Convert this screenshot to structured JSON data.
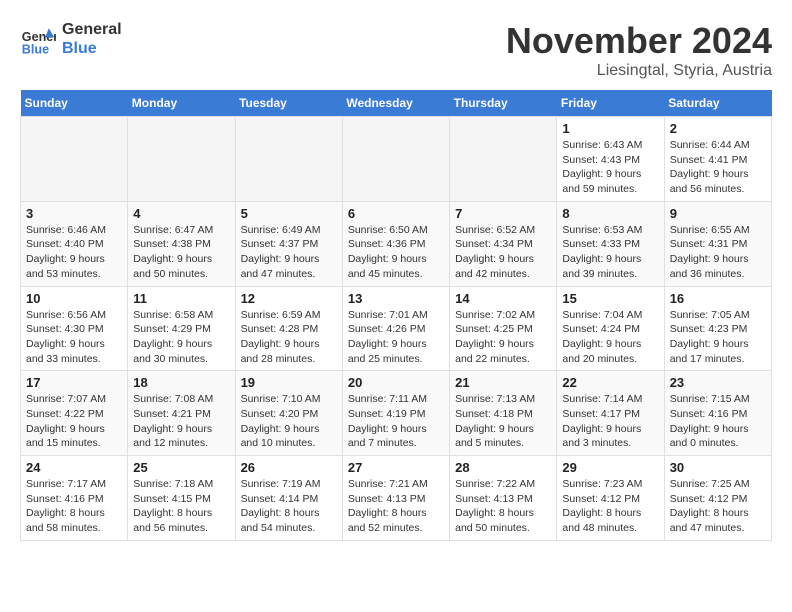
{
  "logo": {
    "text_general": "General",
    "text_blue": "Blue"
  },
  "header": {
    "month": "November 2024",
    "location": "Liesingtal, Styria, Austria"
  },
  "weekdays": [
    "Sunday",
    "Monday",
    "Tuesday",
    "Wednesday",
    "Thursday",
    "Friday",
    "Saturday"
  ],
  "weeks": [
    [
      {
        "day": "",
        "info": ""
      },
      {
        "day": "",
        "info": ""
      },
      {
        "day": "",
        "info": ""
      },
      {
        "day": "",
        "info": ""
      },
      {
        "day": "",
        "info": ""
      },
      {
        "day": "1",
        "info": "Sunrise: 6:43 AM\nSunset: 4:43 PM\nDaylight: 9 hours and 59 minutes."
      },
      {
        "day": "2",
        "info": "Sunrise: 6:44 AM\nSunset: 4:41 PM\nDaylight: 9 hours and 56 minutes."
      }
    ],
    [
      {
        "day": "3",
        "info": "Sunrise: 6:46 AM\nSunset: 4:40 PM\nDaylight: 9 hours and 53 minutes."
      },
      {
        "day": "4",
        "info": "Sunrise: 6:47 AM\nSunset: 4:38 PM\nDaylight: 9 hours and 50 minutes."
      },
      {
        "day": "5",
        "info": "Sunrise: 6:49 AM\nSunset: 4:37 PM\nDaylight: 9 hours and 47 minutes."
      },
      {
        "day": "6",
        "info": "Sunrise: 6:50 AM\nSunset: 4:36 PM\nDaylight: 9 hours and 45 minutes."
      },
      {
        "day": "7",
        "info": "Sunrise: 6:52 AM\nSunset: 4:34 PM\nDaylight: 9 hours and 42 minutes."
      },
      {
        "day": "8",
        "info": "Sunrise: 6:53 AM\nSunset: 4:33 PM\nDaylight: 9 hours and 39 minutes."
      },
      {
        "day": "9",
        "info": "Sunrise: 6:55 AM\nSunset: 4:31 PM\nDaylight: 9 hours and 36 minutes."
      }
    ],
    [
      {
        "day": "10",
        "info": "Sunrise: 6:56 AM\nSunset: 4:30 PM\nDaylight: 9 hours and 33 minutes."
      },
      {
        "day": "11",
        "info": "Sunrise: 6:58 AM\nSunset: 4:29 PM\nDaylight: 9 hours and 30 minutes."
      },
      {
        "day": "12",
        "info": "Sunrise: 6:59 AM\nSunset: 4:28 PM\nDaylight: 9 hours and 28 minutes."
      },
      {
        "day": "13",
        "info": "Sunrise: 7:01 AM\nSunset: 4:26 PM\nDaylight: 9 hours and 25 minutes."
      },
      {
        "day": "14",
        "info": "Sunrise: 7:02 AM\nSunset: 4:25 PM\nDaylight: 9 hours and 22 minutes."
      },
      {
        "day": "15",
        "info": "Sunrise: 7:04 AM\nSunset: 4:24 PM\nDaylight: 9 hours and 20 minutes."
      },
      {
        "day": "16",
        "info": "Sunrise: 7:05 AM\nSunset: 4:23 PM\nDaylight: 9 hours and 17 minutes."
      }
    ],
    [
      {
        "day": "17",
        "info": "Sunrise: 7:07 AM\nSunset: 4:22 PM\nDaylight: 9 hours and 15 minutes."
      },
      {
        "day": "18",
        "info": "Sunrise: 7:08 AM\nSunset: 4:21 PM\nDaylight: 9 hours and 12 minutes."
      },
      {
        "day": "19",
        "info": "Sunrise: 7:10 AM\nSunset: 4:20 PM\nDaylight: 9 hours and 10 minutes."
      },
      {
        "day": "20",
        "info": "Sunrise: 7:11 AM\nSunset: 4:19 PM\nDaylight: 9 hours and 7 minutes."
      },
      {
        "day": "21",
        "info": "Sunrise: 7:13 AM\nSunset: 4:18 PM\nDaylight: 9 hours and 5 minutes."
      },
      {
        "day": "22",
        "info": "Sunrise: 7:14 AM\nSunset: 4:17 PM\nDaylight: 9 hours and 3 minutes."
      },
      {
        "day": "23",
        "info": "Sunrise: 7:15 AM\nSunset: 4:16 PM\nDaylight: 9 hours and 0 minutes."
      }
    ],
    [
      {
        "day": "24",
        "info": "Sunrise: 7:17 AM\nSunset: 4:16 PM\nDaylight: 8 hours and 58 minutes."
      },
      {
        "day": "25",
        "info": "Sunrise: 7:18 AM\nSunset: 4:15 PM\nDaylight: 8 hours and 56 minutes."
      },
      {
        "day": "26",
        "info": "Sunrise: 7:19 AM\nSunset: 4:14 PM\nDaylight: 8 hours and 54 minutes."
      },
      {
        "day": "27",
        "info": "Sunrise: 7:21 AM\nSunset: 4:13 PM\nDaylight: 8 hours and 52 minutes."
      },
      {
        "day": "28",
        "info": "Sunrise: 7:22 AM\nSunset: 4:13 PM\nDaylight: 8 hours and 50 minutes."
      },
      {
        "day": "29",
        "info": "Sunrise: 7:23 AM\nSunset: 4:12 PM\nDaylight: 8 hours and 48 minutes."
      },
      {
        "day": "30",
        "info": "Sunrise: 7:25 AM\nSunset: 4:12 PM\nDaylight: 8 hours and 47 minutes."
      }
    ]
  ]
}
